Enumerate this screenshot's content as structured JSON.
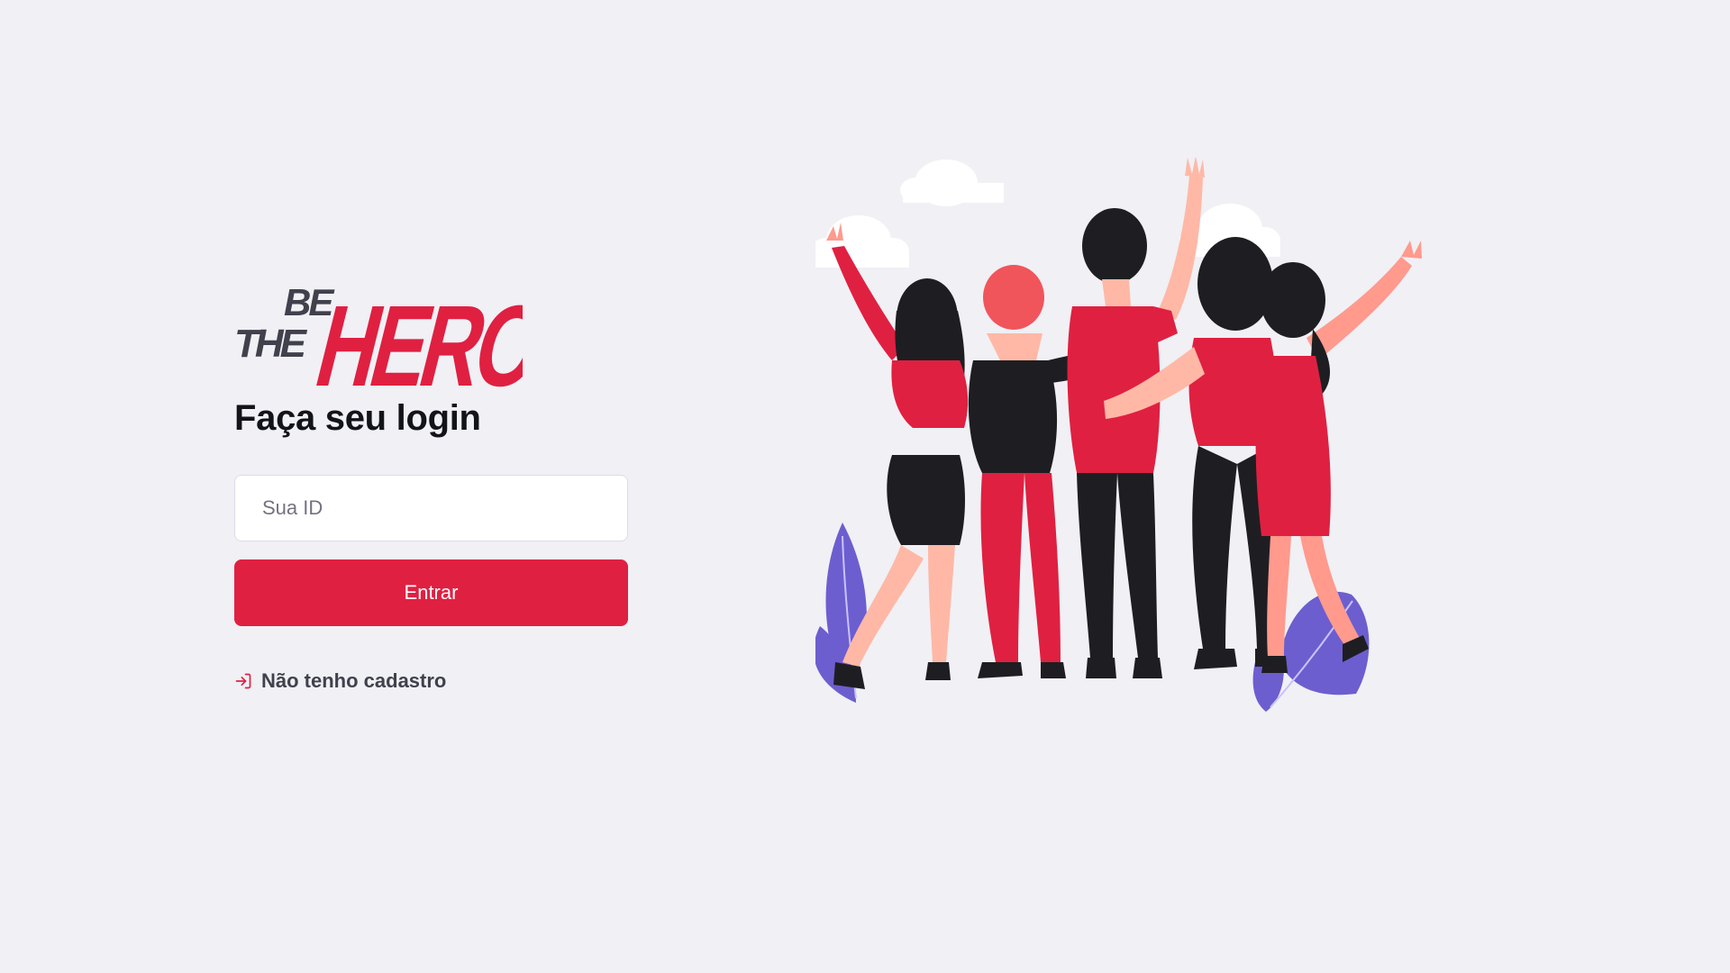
{
  "logo": {
    "line1": "BE",
    "line2": "THE",
    "brand": "HERO",
    "alt": "Be The Hero"
  },
  "login": {
    "title": "Faça seu login",
    "id_placeholder": "Sua ID",
    "submit_label": "Entrar",
    "register_label": "Não tenho cadastro"
  },
  "icons": {
    "register": "log-in-icon"
  },
  "colors": {
    "background": "#f0f0f5",
    "primary": "#e02041",
    "text_dark": "#13131a",
    "text_body": "#41414d",
    "plant": "#6c5ecf"
  }
}
